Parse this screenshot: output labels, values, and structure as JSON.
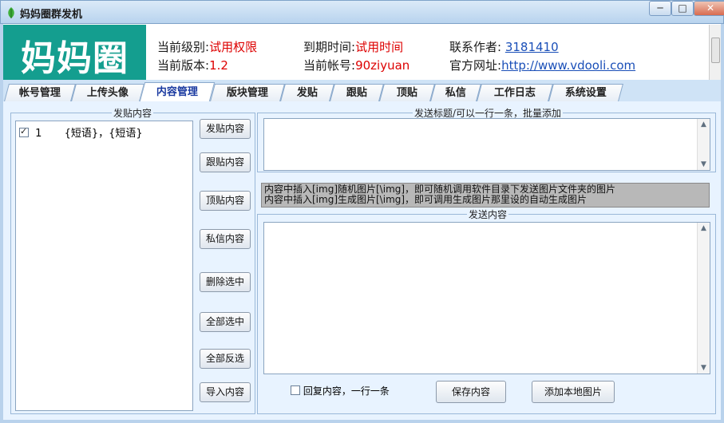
{
  "window": {
    "title": "妈妈圈群发机",
    "minimize_label": "─",
    "maximize_label": "□",
    "close_label": "✕"
  },
  "header": {
    "logo_text": "妈妈圈",
    "level_label": "当前级别:",
    "level_value": "试用权限",
    "expire_label": "到期时间:",
    "expire_value": "试用时间",
    "contact_label": "联系作者:",
    "contact_value": "3181410",
    "version_label": "当前版本:",
    "version_value": "1.2",
    "account_label": "当前帐号:",
    "account_value": "90ziyuan",
    "website_label": "官方网址:",
    "website_value": "http://www.vdooli.com"
  },
  "tabs": [
    "帐号管理",
    "上传头像",
    "内容管理",
    "版块管理",
    "发贴",
    "跟贴",
    "顶贴",
    "私信",
    "工作日志",
    "系统设置"
  ],
  "active_tab": "内容管理",
  "left_panel": {
    "title": "发贴内容",
    "items": [
      {
        "index": "1",
        "text": "{短语}，{短语}",
        "checked": true
      }
    ]
  },
  "buttons": {
    "post": "发贴内容",
    "reply": "跟贴内容",
    "bump": "顶贴内容",
    "pm": "私信内容",
    "delete": "删除选中",
    "select_all": "全部选中",
    "invert": "全部反选",
    "import": "导入内容"
  },
  "right_panel": {
    "title_box_label": "发送标题/可以一行一条，批量添加",
    "hint_line1": "内容中插入[img]随机图片[\\img]，即可随机调用软件目录下发送图片文件夹的图片",
    "hint_line2": "内容中插入[img]生成图片[\\img]，即可调用生成图片那里设的自动生成图片",
    "content_label": "发送内容",
    "reply_checkbox_label": "回复内容，一行一条",
    "save_button": "保存内容",
    "add_image_button": "添加本地图片"
  },
  "colors": {
    "logo_bg": "#149e8f",
    "value_red": "#dd0000",
    "link_blue": "#1a4fb8",
    "panel_bg": "#e8f3ff"
  }
}
